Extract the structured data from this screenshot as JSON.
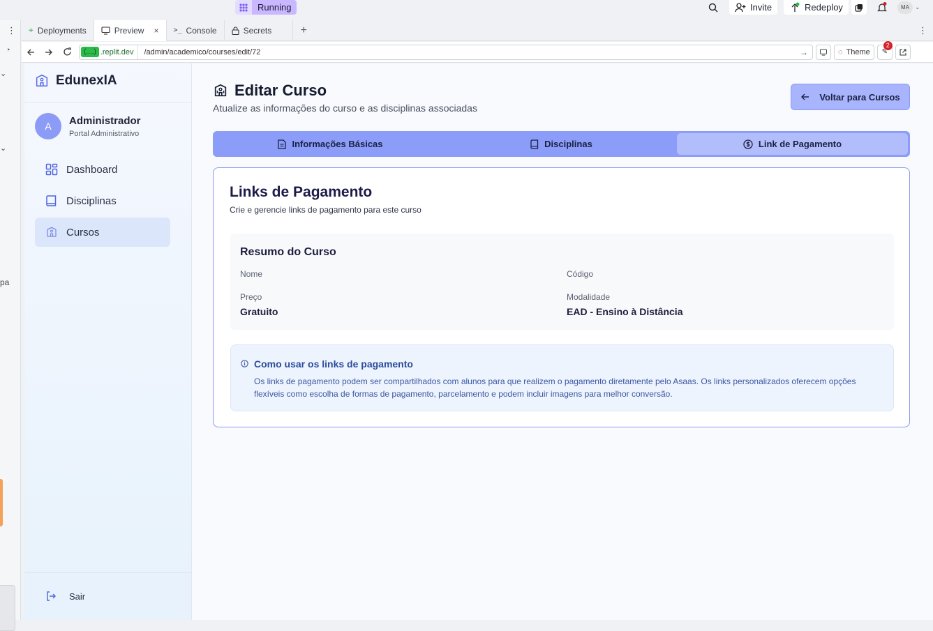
{
  "replit": {
    "run_label": "Running",
    "invite_label": "Invite",
    "redeploy_label": "Redeploy",
    "user_initials": "MA",
    "tabs": [
      {
        "label": "Deployments"
      },
      {
        "label": "Preview"
      },
      {
        "label": "Console"
      },
      {
        "label": "Secrets"
      }
    ],
    "domain_badge": "(....)",
    "domain": ".replit.dev",
    "url_path": "/admin/academico/courses/edit/72",
    "theme_label": "Theme",
    "notification_count": "2",
    "left_panel_fragment": "pa"
  },
  "sidebar": {
    "brand": "EdunexIA",
    "avatar_letter": "A",
    "user_name": "Administrador",
    "user_role": "Portal Administrativo",
    "items": [
      {
        "label": "Dashboard"
      },
      {
        "label": "Disciplinas"
      },
      {
        "label": "Cursos"
      }
    ],
    "logout_label": "Sair"
  },
  "header": {
    "title": "Editar Curso",
    "subtitle": "Atualize as informações do curso e as disciplinas associadas",
    "back_button": "Voltar para Cursos"
  },
  "tabs": [
    {
      "label": "Informações Básicas"
    },
    {
      "label": "Disciplinas"
    },
    {
      "label": "Link de Pagamento"
    }
  ],
  "card": {
    "title": "Links de Pagamento",
    "subtitle": "Crie e gerencie links de pagamento para este curso",
    "summary": {
      "title": "Resumo do Curso",
      "name_label": "Nome",
      "code_label": "Código",
      "price_label": "Preço",
      "price_value": "Gratuito",
      "modality_label": "Modalidade",
      "modality_value": "EAD - Ensino à Distância"
    },
    "info": {
      "title": "Como usar os links de pagamento",
      "text": "Os links de pagamento podem ser compartilhados com alunos para que realizem o pagamento diretamente pelo Asaas. Os links personalizados oferecem opções flexíveis como escolha de formas de pagamento, parcelamento e podem incluir imagens para melhor conversão."
    }
  },
  "colors": {
    "accent": "#8b9cf9",
    "active_tab": "#b2bdfc",
    "back_button": "#a8b4fc",
    "card_border": "#8a98f4",
    "info_bg": "#eef4fd",
    "info_text": "#3956a3"
  }
}
